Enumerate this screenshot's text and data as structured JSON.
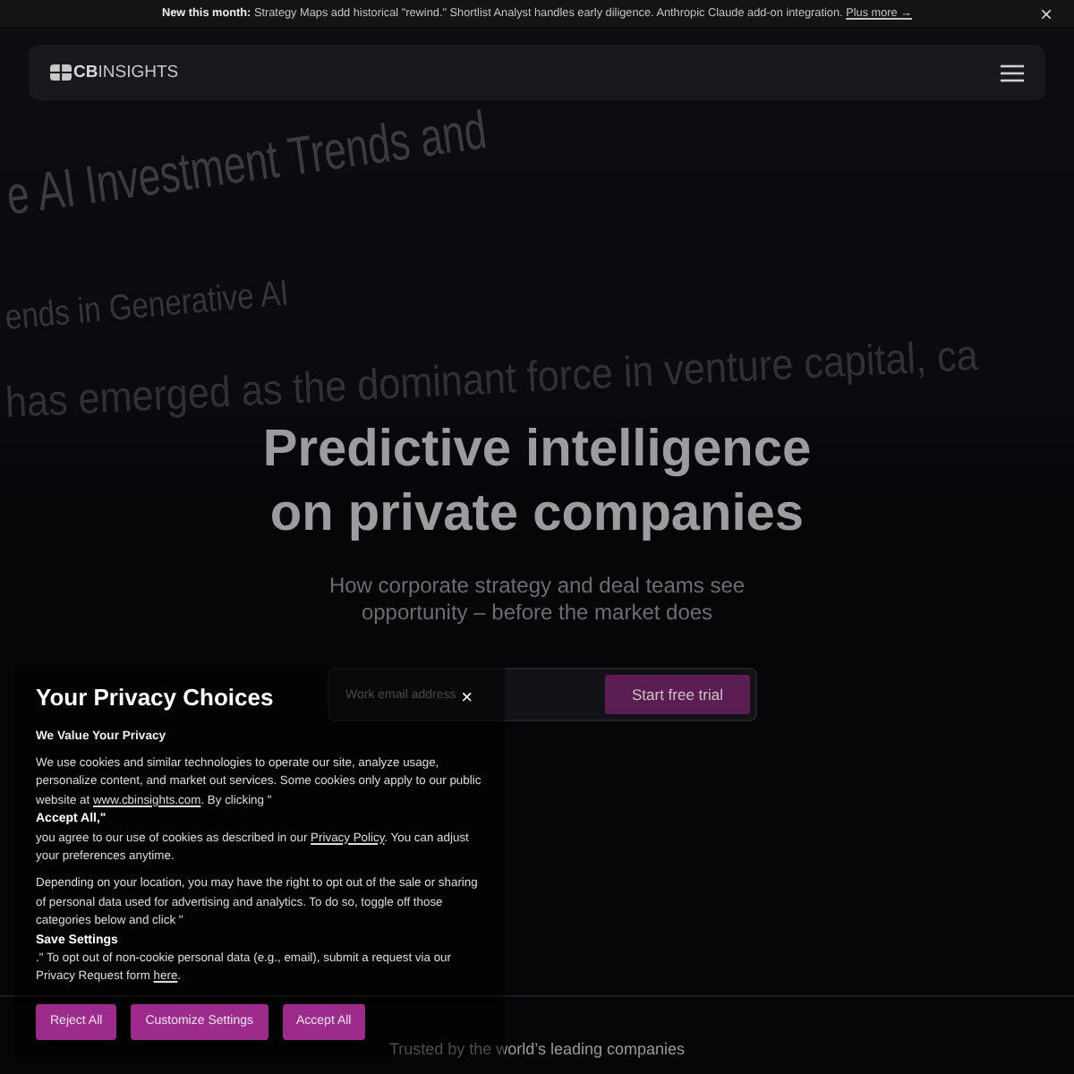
{
  "announcement": {
    "text": "**New this month:** Strategy Maps add historical \"rewind.\" Shortlist Analyst handles early diligence. Anthropic Claude add-on integration.",
    "link": "Plus more →",
    "close": "×"
  },
  "nav": {
    "logo": "**CB**INSIGHTS"
  },
  "background_document": {
    "heading": "e AI Investment Trends and",
    "subheading": "ends in Generative AI",
    "text": "has emerged as the dominant force in venture capital, ca"
  },
  "hero": {
    "title": "Predictive intelligence on private companies",
    "subtitle": "How corporate strategy and deal teams see opportunity – before the market does",
    "email_field": {
      "placeholder": "Work email address"
    },
    "cta": "Start free trial"
  },
  "trusted": {
    "text": "Trusted by the world’s leading companies"
  },
  "privacy_dialog": {
    "title": "Your Privacy Choices",
    "close": "×",
    "heading": "We Value Your Privacy",
    "paragraphs": [
      [
        {
          "kind": "text",
          "text": "We use cookies and similar technologies to operate our site, analyze usage, personalize content, and market out services. Some cookies only apply to our public website at "
        },
        {
          "kind": "link",
          "text": "www.cbinsights.com"
        },
        {
          "kind": "text",
          "text": ". By clicking \""
        },
        {
          "kind": "bold",
          "text": "Accept All,\""
        },
        {
          "kind": "text",
          "text": "you agree to our use of cookies as described in our "
        },
        {
          "kind": "link",
          "text": "Privacy Policy"
        },
        {
          "kind": "text",
          "text": ". You can adjust your preferences anytime."
        }
      ],
      [
        {
          "kind": "text",
          "text": "Depending on your location, you may have the right to opt out of the sale or sharing of personal data used for advertising and analytics. To do so, toggle off those categories below and click \""
        },
        {
          "kind": "bold",
          "text": "Save Settings"
        },
        {
          "kind": "text",
          "text": ".\" To opt out of non-cookie personal data (e.g., email), submit a request via our Privacy Request form "
        },
        {
          "kind": "link",
          "text": "here"
        },
        {
          "kind": "text",
          "text": "."
        }
      ]
    ],
    "buttons": [
      "Reject All",
      "Customize Settings",
      "Accept All"
    ]
  }
}
